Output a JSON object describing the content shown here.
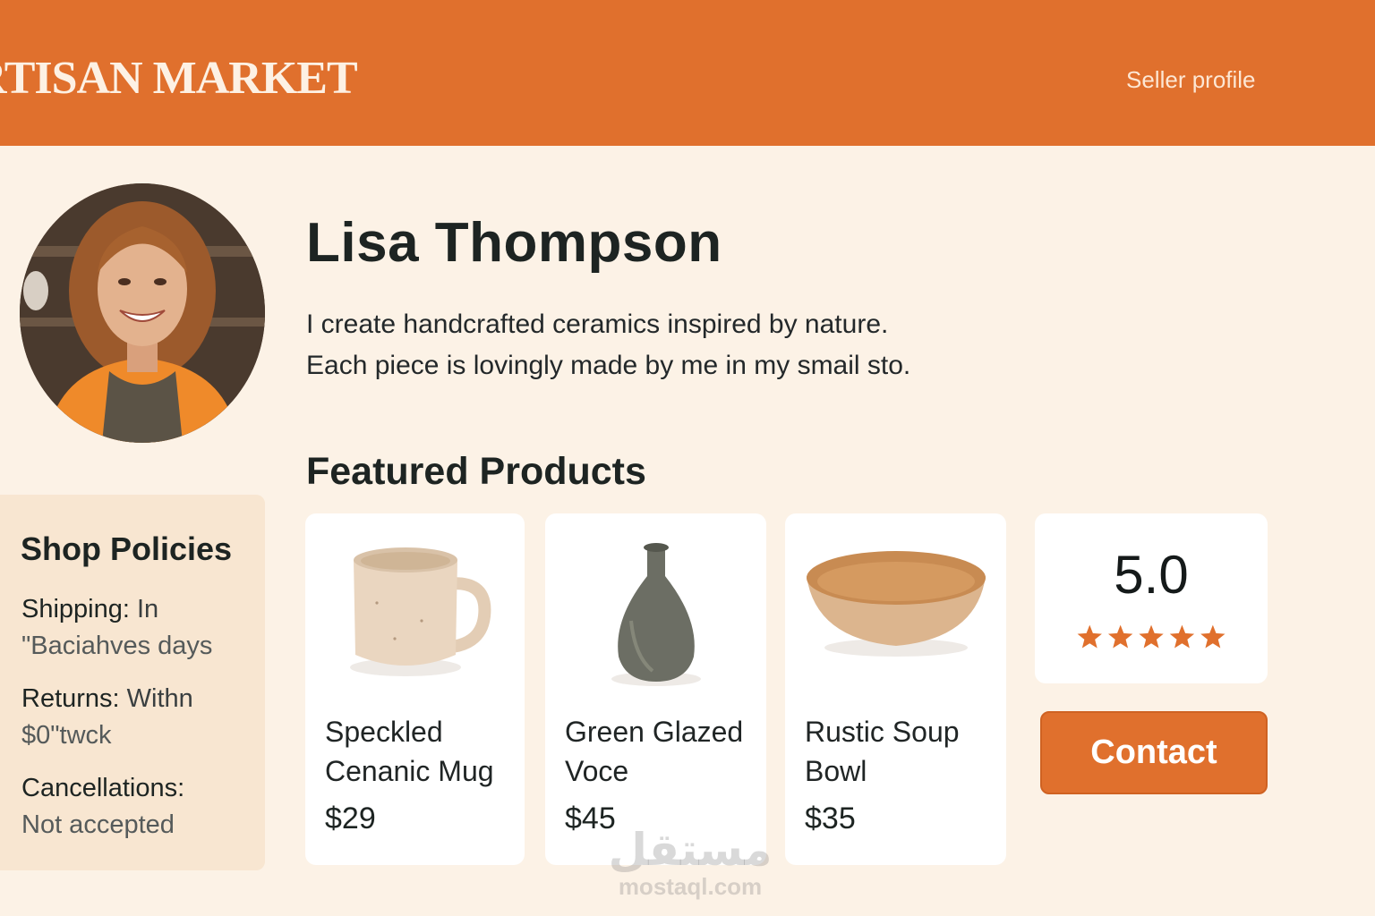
{
  "header": {
    "brand": "RTISAN MARKET",
    "nav_link": "Seller profile"
  },
  "seller": {
    "name": "Lisa Thompson",
    "bio_line1": "I create handcrafted ceramics inspired by nature.",
    "bio_line2": "Each piece is lovingly made by me in my smail sto."
  },
  "featured": {
    "title": "Featured Products",
    "products": [
      {
        "name": "Speckled Cenanic Mug",
        "price": "$29",
        "icon": "mug"
      },
      {
        "name": "Green Glazed Voce",
        "price": "$45",
        "icon": "vase"
      },
      {
        "name": "Rustic Soup Bowl",
        "price": "$35",
        "icon": "bowl"
      }
    ]
  },
  "policies": {
    "title": "Shop Policies",
    "shipping_label": "Shipping:",
    "shipping_value": "In",
    "shipping_value2": "\"Baciahves days",
    "returns_label": "Returns:",
    "returns_value": "Withn",
    "returns_value2": "$0\"twck",
    "cancellations_label": "Cancellations:",
    "cancellations_value": "Not accepted"
  },
  "rating": {
    "value": "5.0",
    "stars": 5,
    "star_color": "#e0702d"
  },
  "contact_label": "Contact",
  "watermark": {
    "arabic": "مستقل",
    "latin": "mostaql.com"
  },
  "colors": {
    "accent": "#e0702d",
    "background": "#fcf2e6",
    "panel": "#f8e6d1"
  }
}
